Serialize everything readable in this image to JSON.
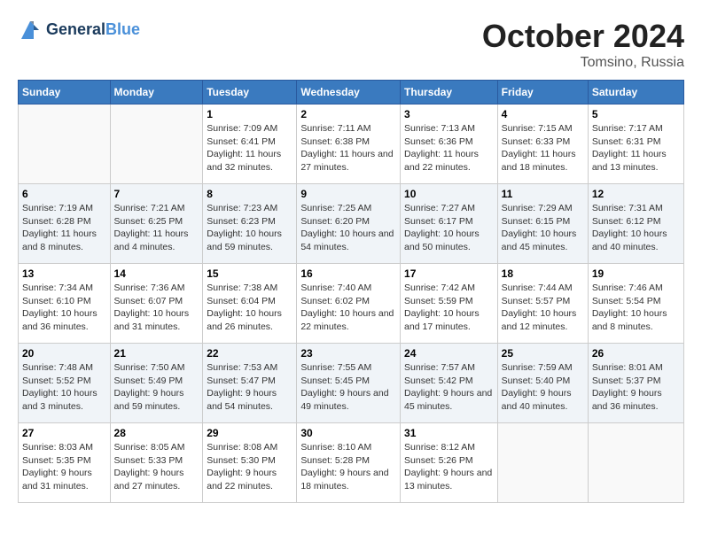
{
  "header": {
    "logo_line1": "General",
    "logo_line2": "Blue",
    "month": "October 2024",
    "location": "Tomsino, Russia"
  },
  "weekdays": [
    "Sunday",
    "Monday",
    "Tuesday",
    "Wednesday",
    "Thursday",
    "Friday",
    "Saturday"
  ],
  "weeks": [
    [
      {
        "day": "",
        "info": ""
      },
      {
        "day": "",
        "info": ""
      },
      {
        "day": "1",
        "info": "Sunrise: 7:09 AM\nSunset: 6:41 PM\nDaylight: 11 hours and 32 minutes."
      },
      {
        "day": "2",
        "info": "Sunrise: 7:11 AM\nSunset: 6:38 PM\nDaylight: 11 hours and 27 minutes."
      },
      {
        "day": "3",
        "info": "Sunrise: 7:13 AM\nSunset: 6:36 PM\nDaylight: 11 hours and 22 minutes."
      },
      {
        "day": "4",
        "info": "Sunrise: 7:15 AM\nSunset: 6:33 PM\nDaylight: 11 hours and 18 minutes."
      },
      {
        "day": "5",
        "info": "Sunrise: 7:17 AM\nSunset: 6:31 PM\nDaylight: 11 hours and 13 minutes."
      }
    ],
    [
      {
        "day": "6",
        "info": "Sunrise: 7:19 AM\nSunset: 6:28 PM\nDaylight: 11 hours and 8 minutes."
      },
      {
        "day": "7",
        "info": "Sunrise: 7:21 AM\nSunset: 6:25 PM\nDaylight: 11 hours and 4 minutes."
      },
      {
        "day": "8",
        "info": "Sunrise: 7:23 AM\nSunset: 6:23 PM\nDaylight: 10 hours and 59 minutes."
      },
      {
        "day": "9",
        "info": "Sunrise: 7:25 AM\nSunset: 6:20 PM\nDaylight: 10 hours and 54 minutes."
      },
      {
        "day": "10",
        "info": "Sunrise: 7:27 AM\nSunset: 6:17 PM\nDaylight: 10 hours and 50 minutes."
      },
      {
        "day": "11",
        "info": "Sunrise: 7:29 AM\nSunset: 6:15 PM\nDaylight: 10 hours and 45 minutes."
      },
      {
        "day": "12",
        "info": "Sunrise: 7:31 AM\nSunset: 6:12 PM\nDaylight: 10 hours and 40 minutes."
      }
    ],
    [
      {
        "day": "13",
        "info": "Sunrise: 7:34 AM\nSunset: 6:10 PM\nDaylight: 10 hours and 36 minutes."
      },
      {
        "day": "14",
        "info": "Sunrise: 7:36 AM\nSunset: 6:07 PM\nDaylight: 10 hours and 31 minutes."
      },
      {
        "day": "15",
        "info": "Sunrise: 7:38 AM\nSunset: 6:04 PM\nDaylight: 10 hours and 26 minutes."
      },
      {
        "day": "16",
        "info": "Sunrise: 7:40 AM\nSunset: 6:02 PM\nDaylight: 10 hours and 22 minutes."
      },
      {
        "day": "17",
        "info": "Sunrise: 7:42 AM\nSunset: 5:59 PM\nDaylight: 10 hours and 17 minutes."
      },
      {
        "day": "18",
        "info": "Sunrise: 7:44 AM\nSunset: 5:57 PM\nDaylight: 10 hours and 12 minutes."
      },
      {
        "day": "19",
        "info": "Sunrise: 7:46 AM\nSunset: 5:54 PM\nDaylight: 10 hours and 8 minutes."
      }
    ],
    [
      {
        "day": "20",
        "info": "Sunrise: 7:48 AM\nSunset: 5:52 PM\nDaylight: 10 hours and 3 minutes."
      },
      {
        "day": "21",
        "info": "Sunrise: 7:50 AM\nSunset: 5:49 PM\nDaylight: 9 hours and 59 minutes."
      },
      {
        "day": "22",
        "info": "Sunrise: 7:53 AM\nSunset: 5:47 PM\nDaylight: 9 hours and 54 minutes."
      },
      {
        "day": "23",
        "info": "Sunrise: 7:55 AM\nSunset: 5:45 PM\nDaylight: 9 hours and 49 minutes."
      },
      {
        "day": "24",
        "info": "Sunrise: 7:57 AM\nSunset: 5:42 PM\nDaylight: 9 hours and 45 minutes."
      },
      {
        "day": "25",
        "info": "Sunrise: 7:59 AM\nSunset: 5:40 PM\nDaylight: 9 hours and 40 minutes."
      },
      {
        "day": "26",
        "info": "Sunrise: 8:01 AM\nSunset: 5:37 PM\nDaylight: 9 hours and 36 minutes."
      }
    ],
    [
      {
        "day": "27",
        "info": "Sunrise: 8:03 AM\nSunset: 5:35 PM\nDaylight: 9 hours and 31 minutes."
      },
      {
        "day": "28",
        "info": "Sunrise: 8:05 AM\nSunset: 5:33 PM\nDaylight: 9 hours and 27 minutes."
      },
      {
        "day": "29",
        "info": "Sunrise: 8:08 AM\nSunset: 5:30 PM\nDaylight: 9 hours and 22 minutes."
      },
      {
        "day": "30",
        "info": "Sunrise: 8:10 AM\nSunset: 5:28 PM\nDaylight: 9 hours and 18 minutes."
      },
      {
        "day": "31",
        "info": "Sunrise: 8:12 AM\nSunset: 5:26 PM\nDaylight: 9 hours and 13 minutes."
      },
      {
        "day": "",
        "info": ""
      },
      {
        "day": "",
        "info": ""
      }
    ]
  ]
}
